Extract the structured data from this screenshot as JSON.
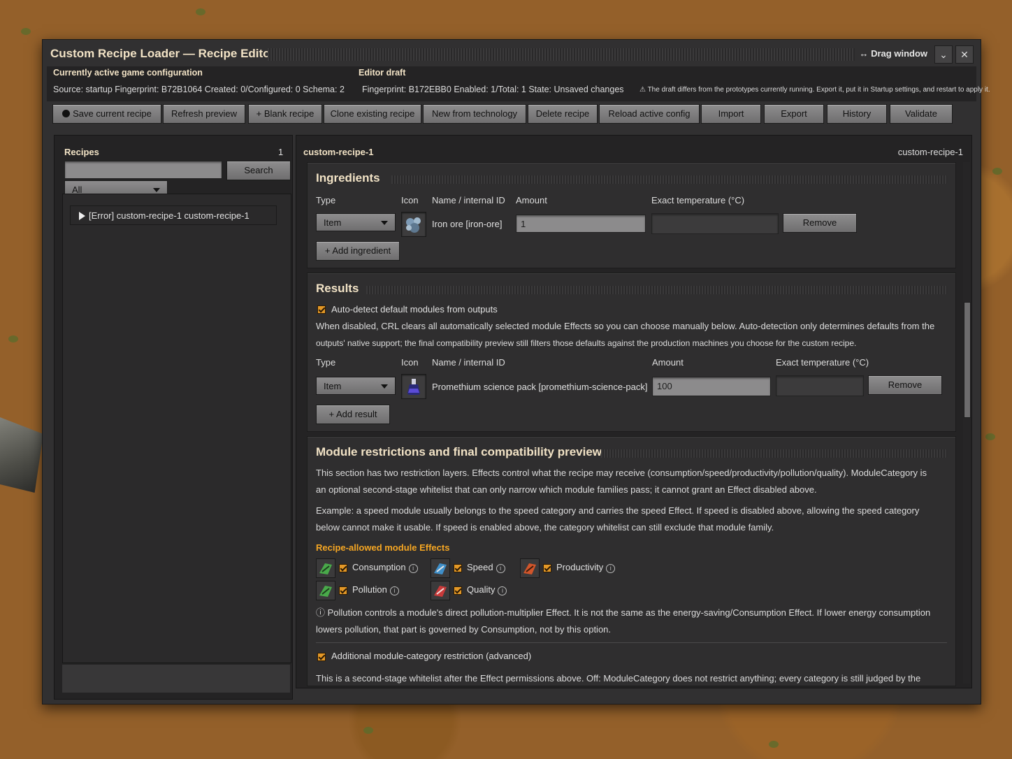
{
  "window": {
    "title": "Custom Recipe Loader — Recipe Editor",
    "drag_label": "↔ Drag window",
    "collapse_glyph": "⌄",
    "close_glyph": "✕"
  },
  "info": {
    "active_heading": "Currently active game configuration",
    "active_line": "Source: startup  Fingerprint: B72B1064  Created: 0/Configured: 0  Schema: 2",
    "draft_heading": "Editor draft",
    "draft_line": "Fingerprint: B172EBB0  Enabled: 1/Total: 1  State: Unsaved changes",
    "warning": "⚠ The draft differs from the prototypes currently running. Export it, put it in Startup settings, and restart to apply it."
  },
  "toolbar": {
    "save": "Save current recipe",
    "refresh": "Refresh preview",
    "blank": "+ Blank recipe",
    "clone": "Clone existing recipe",
    "new_tech": "New from technology",
    "delete": "Delete recipe",
    "reload": "Reload active config",
    "import": "Import",
    "export": "Export",
    "history": "History",
    "validate": "Validate"
  },
  "recipes_panel": {
    "heading": "Recipes",
    "count": "1",
    "search_value": "",
    "search_button": "Search",
    "filter_value": "All",
    "items": [
      {
        "label": "[Error] custom-recipe-1 custom-recipe-1"
      }
    ]
  },
  "editor": {
    "recipe_name": "custom-recipe-1",
    "recipe_name_right": "custom-recipe-1"
  },
  "ingredients": {
    "title": "Ingredients",
    "col_type": "Type",
    "col_icon": "Icon",
    "col_name": "Name / internal ID",
    "col_amount": "Amount",
    "col_temp": "Exact temperature (°C)",
    "row": {
      "type": "Item",
      "icon": "iron-ore-icon",
      "name": "Iron ore  [iron-ore]",
      "amount": "1",
      "temperature": "",
      "remove": "Remove"
    },
    "add_button": "+ Add ingredient"
  },
  "results": {
    "title": "Results",
    "auto_detect_label": "Auto-detect default modules from outputs",
    "auto_detect_checked": true,
    "description_1": "When disabled, CRL clears all automatically selected module Effects so you can choose manually below. Auto-detection only determines defaults from the",
    "description_2": "outputs' native support; the final compatibility preview still filters those defaults against the production machines you choose for the custom recipe.",
    "col_type": "Type",
    "col_icon": "Icon",
    "col_name": "Name / internal ID",
    "col_amount": "Amount",
    "col_temp": "Exact temperature (°C)",
    "row": {
      "type": "Item",
      "icon": "promethium-science-pack-icon",
      "name": "Promethium science pack  [promethium-science-pack]",
      "amount": "100",
      "temperature": "",
      "remove": "Remove"
    },
    "add_button": "+ Add result"
  },
  "modules": {
    "title": "Module restrictions and final compatibility preview",
    "para1_a": "This section has two restriction layers. Effects control what the recipe may receive (consumption/speed/productivity/pollution/quality). ModuleCategory is",
    "para1_b": "an optional second-stage whitelist that can only narrow which module families pass; it cannot grant an Effect disabled above.",
    "para2_a": "Example: a speed module usually belongs to the speed category and carries the speed Effect. If speed is disabled above, allowing the speed category",
    "para2_b": "below cannot make it usable. If speed is enabled above, the category whitelist can still exclude that module family.",
    "effects_heading": "Recipe-allowed module Effects",
    "effects": [
      {
        "label": "Consumption",
        "checked": true,
        "icon": "consumption-module-icon",
        "color": "#49a94a"
      },
      {
        "label": "Speed",
        "checked": true,
        "icon": "speed-module-icon",
        "color": "#3f8fc9"
      },
      {
        "label": "Productivity",
        "checked": true,
        "icon": "productivity-module-icon",
        "color": "#d0552b"
      },
      {
        "label": "Pollution",
        "checked": true,
        "icon": "pollution-module-icon",
        "color": "#49a94a"
      },
      {
        "label": "Quality",
        "checked": true,
        "icon": "quality-module-icon",
        "color": "#c83a3a"
      }
    ],
    "pollution_note_a": "ⓘ Pollution controls a module's direct pollution-multiplier Effect. It is not the same as the energy-saving/Consumption Effect. If lower energy consumption",
    "pollution_note_b": "lowers pollution, that part is governed by Consumption, not by this option.",
    "category_label": "Additional module-category restriction (advanced)",
    "category_checked": true,
    "category_desc": "This is a second-stage whitelist after the Effect permissions above. Off: ModuleCategory does not restrict anything; every category is still judged by the"
  },
  "colors": {
    "accent_orange": "#e39827",
    "heading_cream": "#f2e3c6",
    "panel_dark": "#242324",
    "button_grey": "#7f7e7f"
  }
}
